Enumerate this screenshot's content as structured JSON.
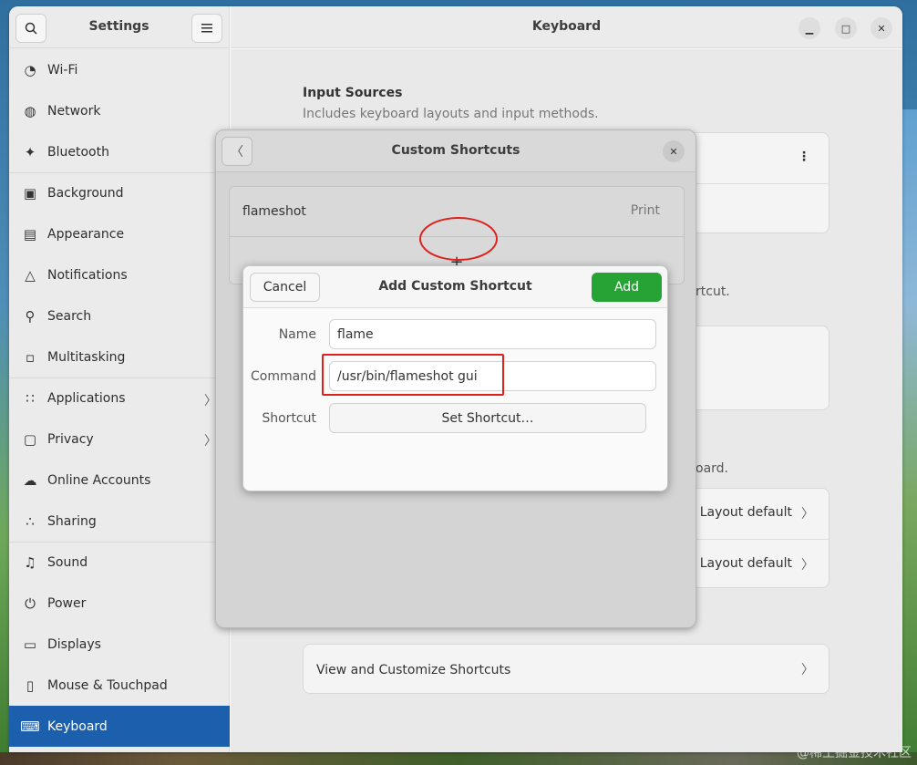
{
  "sidebar": {
    "title": "Settings",
    "items": [
      {
        "label": "Wi-Fi",
        "icon": "wifi-icon",
        "glyph": "◔"
      },
      {
        "label": "Network",
        "icon": "network-icon",
        "glyph": "◍"
      },
      {
        "label": "Bluetooth",
        "icon": "bluetooth-icon",
        "glyph": "✦"
      },
      {
        "label": "Background",
        "icon": "background-icon",
        "glyph": "▣"
      },
      {
        "label": "Appearance",
        "icon": "appearance-icon",
        "glyph": "▤"
      },
      {
        "label": "Notifications",
        "icon": "bell-icon",
        "glyph": "△"
      },
      {
        "label": "Search",
        "icon": "search-icon",
        "glyph": "⚲"
      },
      {
        "label": "Multitasking",
        "icon": "multitasking-icon",
        "glyph": "▫"
      },
      {
        "label": "Applications",
        "icon": "apps-grid-icon",
        "glyph": "∷"
      },
      {
        "label": "Privacy",
        "icon": "lock-icon",
        "glyph": "▢"
      },
      {
        "label": "Online Accounts",
        "icon": "cloud-icon",
        "glyph": "☁"
      },
      {
        "label": "Sharing",
        "icon": "share-icon",
        "glyph": "∴"
      },
      {
        "label": "Sound",
        "icon": "music-note-icon",
        "glyph": "♫"
      },
      {
        "label": "Power",
        "icon": "power-icon",
        "glyph": "⏻"
      },
      {
        "label": "Displays",
        "icon": "display-icon",
        "glyph": "▭"
      },
      {
        "label": "Mouse & Touchpad",
        "icon": "mouse-icon",
        "glyph": "▯"
      },
      {
        "label": "Keyboard",
        "icon": "keyboard-icon",
        "glyph": "⌨"
      }
    ]
  },
  "content": {
    "title": "Keyboard",
    "input_sources_title": "Input Sources",
    "input_sources_sub": "Includes keyboard layouts and input methods.",
    "partial_sub_1": "rtcut.",
    "partial_sub_2": "oard.",
    "layout_rows": [
      "Layout default",
      "Layout default"
    ],
    "view_shortcuts_label": "View and Customize Shortcuts"
  },
  "custom_shortcuts": {
    "title": "Custom Shortcuts",
    "rows": [
      {
        "name": "flameshot",
        "accel": "Print"
      }
    ],
    "add_glyph": "+"
  },
  "add_shortcut": {
    "title": "Add Custom Shortcut",
    "cancel_label": "Cancel",
    "add_label": "Add",
    "name_label": "Name",
    "name_value": "flame",
    "command_label": "Command",
    "command_value": "/usr/bin/flameshot gui",
    "shortcut_label": "Shortcut",
    "set_shortcut_label": "Set Shortcut…"
  },
  "watermark": "@稀土掘金技术社区",
  "colors": {
    "accent": "#1c5fad",
    "add_button": "#26a334",
    "annotation": "#e0201c"
  }
}
